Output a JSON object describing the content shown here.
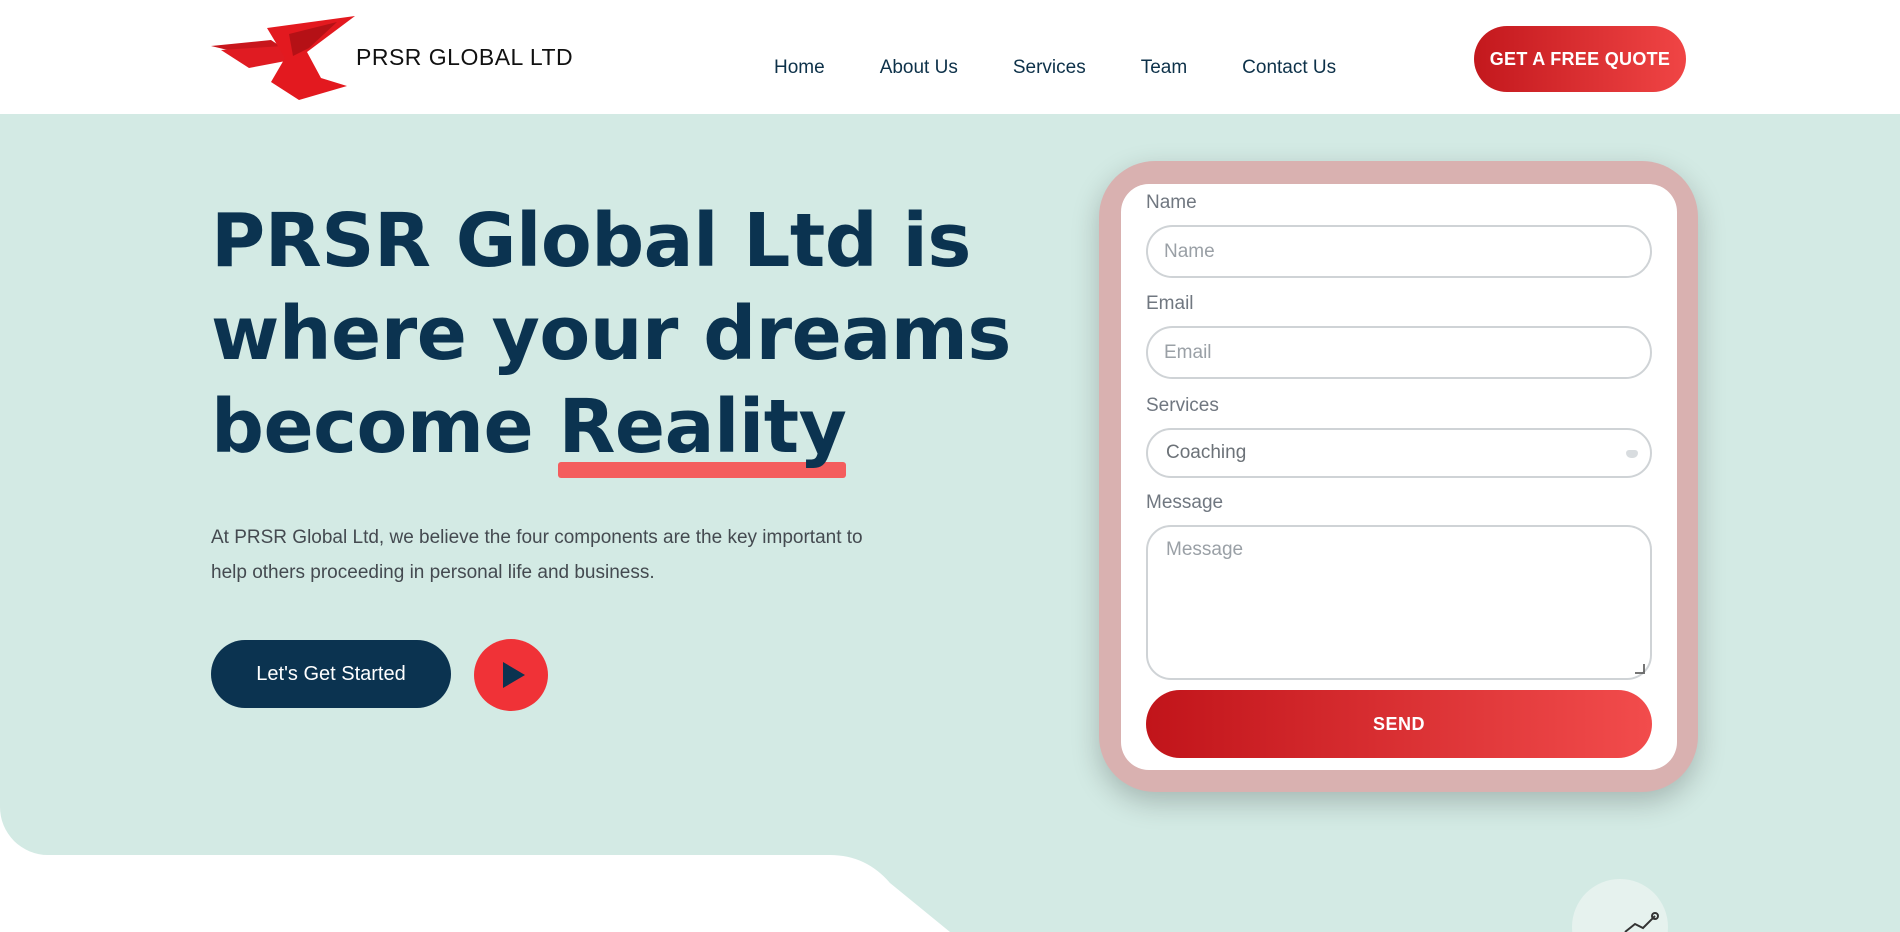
{
  "header": {
    "brand": "PRSR GLOBAL LTD",
    "logo_icon": "eagle-logo-icon",
    "nav": [
      "Home",
      "About Us",
      "Services",
      "Team",
      "Contact Us"
    ],
    "cta_label": "GET A FREE QUOTE"
  },
  "hero": {
    "headline_line1": "PRSR Global Ltd is",
    "headline_line2": "where your dreams",
    "headline_line3_prefix": "become",
    "headline_highlight": "Reality",
    "description": "At PRSR Global Ltd, we believe the four components are the key important to help others proceeding in personal life and business.",
    "start_label": "Let's Get Started",
    "play_icon": "play-icon"
  },
  "form": {
    "name_label": "Name",
    "name_placeholder": "Name",
    "email_label": "Email",
    "email_placeholder": "Email",
    "services_label": "Services",
    "services_selected": "Coaching",
    "message_label": "Message",
    "message_placeholder": "Message",
    "send_label": "SEND"
  },
  "colors": {
    "primary_navy": "#0b3350",
    "accent_red": "#f03237",
    "hero_bg": "#d3eae4",
    "form_frame": "#d9b1b0"
  }
}
